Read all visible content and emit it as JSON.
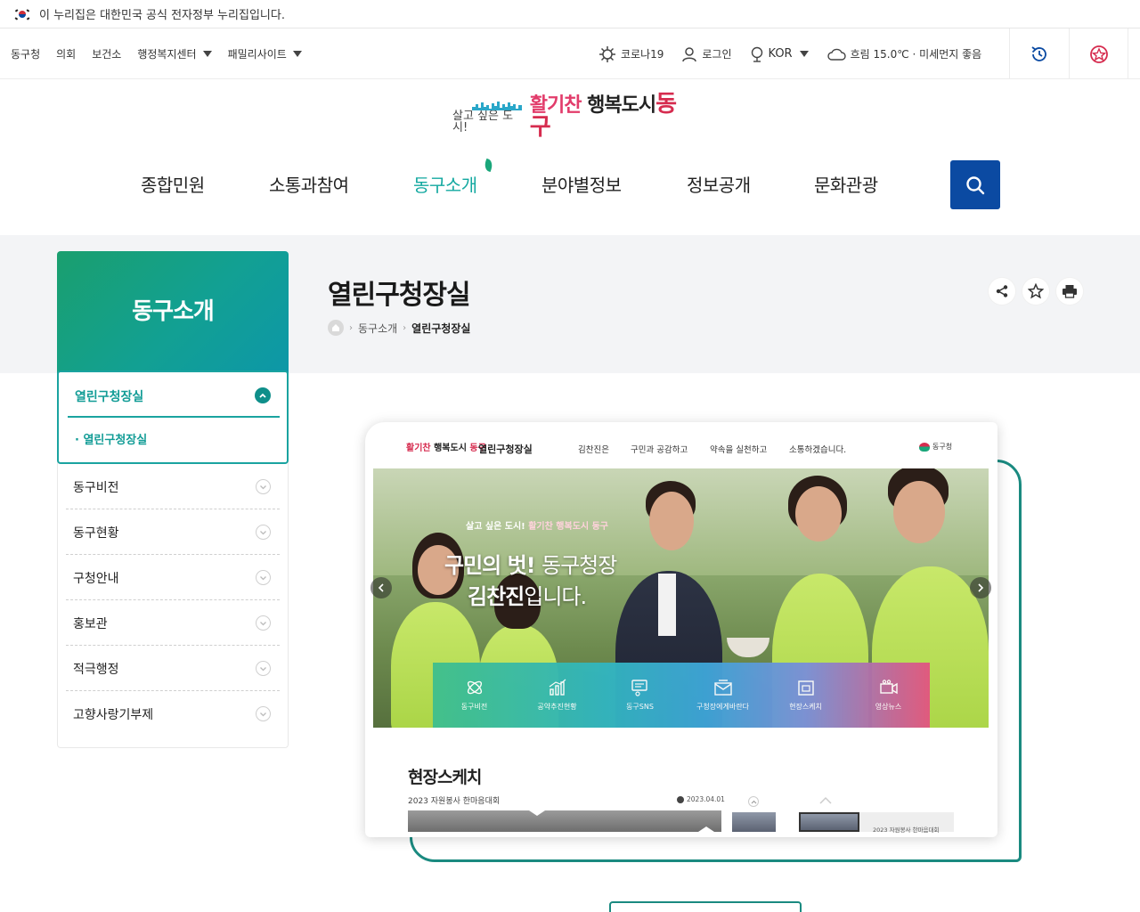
{
  "gov_banner": {
    "text": "이 누리집은 대한민국 공식 전자정부 누리집입니다."
  },
  "util_left": [
    {
      "label": "동구청",
      "dropdown": false
    },
    {
      "label": "의회",
      "dropdown": false
    },
    {
      "label": "보건소",
      "dropdown": false
    },
    {
      "label": "행정복지센터",
      "dropdown": true
    },
    {
      "label": "패밀리사이트",
      "dropdown": true
    }
  ],
  "util_right": {
    "corona": "코로나19",
    "login": "로그인",
    "language": "KOR",
    "weather": "흐림 15.0℃ · 미세먼지 좋음"
  },
  "logo": {
    "small": "살고 싶은 도시!",
    "part1": "활기찬",
    "part2": "행복도시",
    "part3": "동구"
  },
  "gnb": [
    {
      "label": "종합민원",
      "active": false
    },
    {
      "label": "소통과참여",
      "active": false
    },
    {
      "label": "동구소개",
      "active": true
    },
    {
      "label": "분야별정보",
      "active": false
    },
    {
      "label": "정보공개",
      "active": false
    },
    {
      "label": "문화관광",
      "active": false
    }
  ],
  "sidebar": {
    "title": "동구소개",
    "active_group": "열린구청장실",
    "active_sub": "열린구청장실",
    "items": [
      "동구비전",
      "동구현황",
      "구청안내",
      "홍보관",
      "적극행정",
      "고향사랑기부제"
    ]
  },
  "page": {
    "title": "열린구청장실",
    "breadcrumb": [
      "동구소개",
      "열린구청장실"
    ]
  },
  "preview": {
    "mini_logo_a": "활기찬",
    "mini_logo_b": "행복도시",
    "mini_logo_c": "동구",
    "site_name": "열린구청장실",
    "nav": [
      "김찬진은",
      "구민과 공감하고",
      "약속을 실천하고",
      "소통하겠습니다."
    ],
    "emblem": "동구청",
    "slogan_small": "살고 싶은 도시!",
    "slogan_brand": "활기찬 행복도시 동구",
    "headline_bold1": "구민의 벗!",
    "headline_light1": "동구청장",
    "headline_bold2": "김찬진",
    "headline_light2": "입니다.",
    "quick": [
      "동구비전",
      "공약추진현황",
      "동구SNS",
      "구청장에게바란다",
      "현장스케치",
      "영상뉴스"
    ],
    "sketch_title": "현장스케치",
    "sketch_sub": "2023 자원봉사 한마음대회",
    "sketch_date": "2023.04.01",
    "thumb_caption": "2023 자원봉사 한마음대회"
  },
  "colors": {
    "accent": "#13a8a0",
    "brand_blue": "#0b4aa2",
    "brand_red": "#d62c4f"
  }
}
